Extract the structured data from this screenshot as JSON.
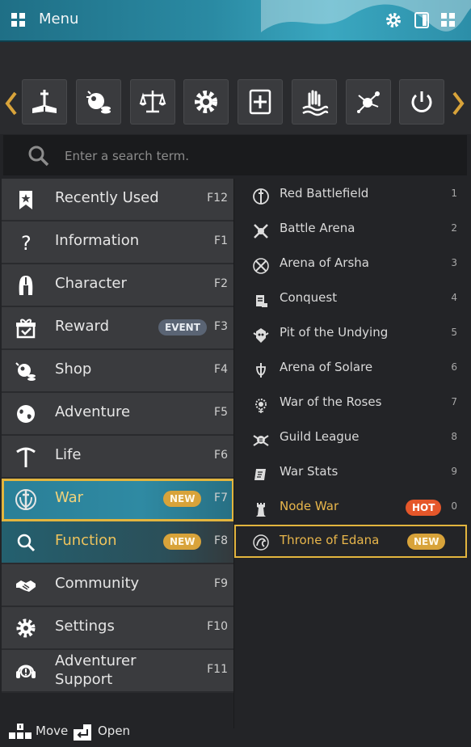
{
  "header": {
    "title": "Menu"
  },
  "search": {
    "placeholder": "Enter a search term."
  },
  "quickbar": {
    "icons": [
      "book-sword-icon",
      "pearl-shop-icon",
      "scales-icon",
      "gear-icon",
      "add-book-icon",
      "hand-wave-icon",
      "network-icon",
      "power-icon"
    ]
  },
  "menu": {
    "items": [
      {
        "label": "Recently Used",
        "key": "F12",
        "icon": "bookmark-star-icon"
      },
      {
        "label": "Information",
        "key": "F1",
        "icon": "question-icon"
      },
      {
        "label": "Character",
        "key": "F2",
        "icon": "helmet-icon"
      },
      {
        "label": "Reward",
        "key": "F3",
        "icon": "gift-icon",
        "badge": "EVENT"
      },
      {
        "label": "Shop",
        "key": "F4",
        "icon": "pearl-coins-icon"
      },
      {
        "label": "Adventure",
        "key": "F5",
        "icon": "globe-icon"
      },
      {
        "label": "Life",
        "key": "F6",
        "icon": "pickaxe-icon"
      },
      {
        "label": "War",
        "key": "F7",
        "icon": "war-shield-icon",
        "badge": "NEW"
      },
      {
        "label": "Function",
        "key": "F8",
        "icon": "magnifier-icon",
        "badge": "NEW"
      },
      {
        "label": "Community",
        "key": "F9",
        "icon": "handshake-icon"
      },
      {
        "label": "Settings",
        "key": "F10",
        "icon": "gear-icon"
      },
      {
        "label": "Adventurer\nSupport",
        "label_line1": "Adventurer",
        "label_line2": "Support",
        "key": "F11",
        "icon": "headset-icon"
      }
    ]
  },
  "submenu": {
    "items": [
      {
        "label": "Red Battlefield",
        "num": "1",
        "icon": "red-battlefield-icon"
      },
      {
        "label": "Battle Arena",
        "num": "2",
        "icon": "battle-arena-icon"
      },
      {
        "label": "Arena of Arsha",
        "num": "3",
        "icon": "arsha-icon"
      },
      {
        "label": "Conquest",
        "num": "4",
        "icon": "conquest-icon"
      },
      {
        "label": "Pit of the Undying",
        "num": "5",
        "icon": "undying-icon"
      },
      {
        "label": "Arena of Solare",
        "num": "6",
        "icon": "solare-icon"
      },
      {
        "label": "War of the Roses",
        "num": "7",
        "icon": "roses-icon"
      },
      {
        "label": "Guild League",
        "num": "8",
        "icon": "guild-league-icon"
      },
      {
        "label": "War Stats",
        "num": "9",
        "icon": "war-stats-icon"
      },
      {
        "label": "Node War",
        "num": "0",
        "icon": "tower-icon",
        "badge": "HOT"
      },
      {
        "label": "Throne of Edana",
        "num": "",
        "icon": "edana-icon",
        "badge": "NEW"
      }
    ]
  },
  "footer": {
    "move_label": "Move",
    "open_label": "Open"
  },
  "colors": {
    "accent_gold": "#e3b53e",
    "header_teal": "#2a8aa3",
    "badge_new": "#d8a33a",
    "badge_hot": "#e5572a",
    "badge_event": "#5a6474"
  }
}
